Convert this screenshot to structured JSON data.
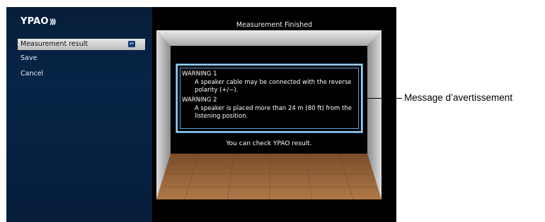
{
  "app": {
    "logo": "YPAO",
    "logo_waves": ")))"
  },
  "menu": {
    "items": [
      {
        "label": "Measurement result",
        "selected": true,
        "icon": "enter-icon"
      },
      {
        "label": "Save",
        "selected": false
      },
      {
        "label": "Cancel",
        "selected": false
      }
    ]
  },
  "main": {
    "title": "Measurement Finished",
    "warnings": [
      {
        "title": "WARNING 1",
        "text": "A speaker cable may be connected with the reverse polarity (+/−)."
      },
      {
        "title": "WARNING 2",
        "text": "A speaker is placed more than 24 m (80 ft) from the listening position."
      }
    ],
    "note": "You can check YPAO result."
  },
  "callout": {
    "text": "Message d’avertissement"
  },
  "colors": {
    "panel": "#072547",
    "highlight_border": "#9fd0f2",
    "selected_bg": "#d6d6d6",
    "floor": "#a0663a"
  }
}
